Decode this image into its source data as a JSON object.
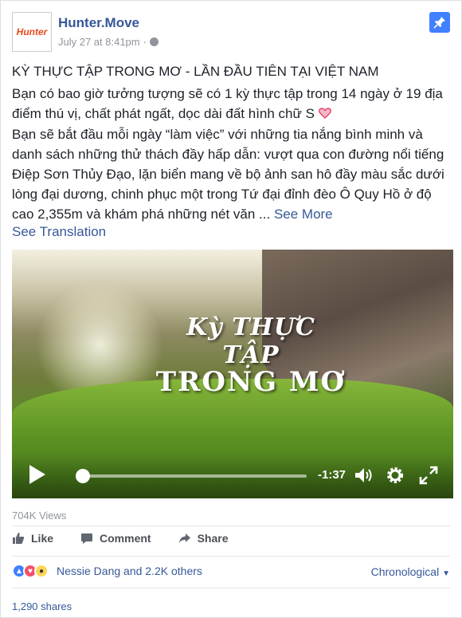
{
  "post": {
    "page_name": "Hunter.Move",
    "avatar_text": "Hunter",
    "timestamp": "July 27 at 8:41pm",
    "meta_separator": "·",
    "title": "KỲ THỰC TẬP TRONG MƠ - LẦN ĐẦU TIÊN TẠI VIỆT NAM",
    "para1": "Bạn có bao giờ tưởng tượng sẽ có 1 kỳ thực tập trong 14 ngày ở 19 địa điểm thú vị, chất phát ngất, dọc dài đất hình chữ S",
    "para2": "Bạn sẽ bắt đầu mỗi ngày “làm việc” với những tia nắng bình minh và danh sách những thử thách đầy hấp dẫn: vượt qua con đường nổi tiếng Điệp Sơn Thủy Đạo, lặn biển mang về bộ ảnh san hô đầy màu sắc dưới lòng đại dương, chinh phục một trong Tứ đại đỉnh đèo Ô Quy Hồ ở độ cao 2,355m và khám phá những nét văn ...",
    "see_more": "See More",
    "see_translation": "See Translation"
  },
  "video": {
    "overlay_line1": "Kỳ THỰC TẬP",
    "overlay_line2": "TRONG MƠ",
    "time_remaining": "-1:37",
    "progress": 0.03
  },
  "stats": {
    "views": "704K Views",
    "reactions_text": "Nessie Dang and 2.2K others",
    "sort_label": "Chronological",
    "shares": "1,290 shares"
  },
  "actions": {
    "like": "Like",
    "comment": "Comment",
    "share": "Share"
  },
  "colors": {
    "link": "#365899",
    "pin": "#4080ff",
    "heart": "#f25268"
  }
}
